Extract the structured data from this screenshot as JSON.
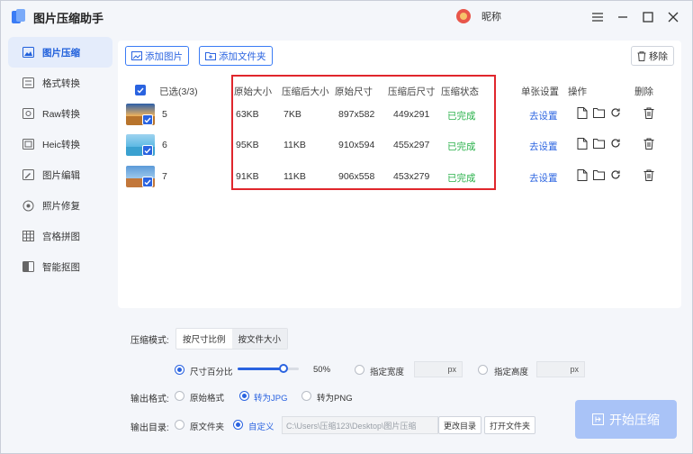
{
  "app": {
    "title": "图片压缩助手",
    "user_name": "昵称"
  },
  "sidebar": {
    "items": [
      {
        "label": "图片压缩",
        "icon": "image-compress-icon",
        "active": true
      },
      {
        "label": "格式转换",
        "icon": "format-convert-icon",
        "active": false
      },
      {
        "label": "Raw转换",
        "icon": "raw-convert-icon",
        "active": false
      },
      {
        "label": "Heic转换",
        "icon": "heic-convert-icon",
        "active": false
      },
      {
        "label": "图片编辑",
        "icon": "image-edit-icon",
        "active": false
      },
      {
        "label": "照片修复",
        "icon": "photo-repair-icon",
        "active": false
      },
      {
        "label": "宫格拼图",
        "icon": "grid-collage-icon",
        "active": false
      },
      {
        "label": "智能抠图",
        "icon": "smart-cutout-icon",
        "active": false
      }
    ]
  },
  "toolbar": {
    "add_image": "添加图片",
    "add_folder": "添加文件夹",
    "remove": "移除"
  },
  "table": {
    "selected": "已选(3/3)",
    "headers": {
      "orig_size": "原始大小",
      "comp_size": "压缩后大小",
      "orig_dim": "原始尺寸",
      "comp_dim": "压缩后尺寸",
      "status": "压缩状态",
      "single": "单张设置",
      "ops": "操作",
      "delete": "删除"
    },
    "rows": [
      {
        "name": "5",
        "orig_size": "63KB",
        "comp_size": "7KB",
        "orig_dim": "897x582",
        "comp_dim": "449x291",
        "status": "已完成",
        "setting": "去设置"
      },
      {
        "name": "6",
        "orig_size": "95KB",
        "comp_size": "11KB",
        "orig_dim": "910x594",
        "comp_dim": "455x297",
        "status": "已完成",
        "setting": "去设置"
      },
      {
        "name": "7",
        "orig_size": "91KB",
        "comp_size": "11KB",
        "orig_dim": "906x558",
        "comp_dim": "453x279",
        "status": "已完成",
        "setting": "去设置"
      }
    ]
  },
  "settings": {
    "mode_label": "压缩模式:",
    "mode_options": [
      "按尺寸比例",
      "按文件大小"
    ],
    "size_percent_label": "尺寸百分比",
    "percent_value": "50%",
    "percent_fraction": 0.5,
    "width_label": "指定宽度",
    "height_label": "指定高度",
    "px_unit": "px",
    "format_label": "输出格式:",
    "format_options": [
      "原始格式",
      "转为JPG",
      "转为PNG"
    ],
    "dir_label": "输出目录:",
    "dir_options": [
      "原文件夹",
      "自定义"
    ],
    "dir_path": "C:\\Users\\压缩123\\Desktop\\图片压缩",
    "change_dir": "更改目录",
    "open_folder": "打开文件夹"
  },
  "start_button": "开始压缩",
  "colors": {
    "accent": "#2a63e0",
    "success": "#29b14a",
    "highlight_box": "#e0262c"
  }
}
